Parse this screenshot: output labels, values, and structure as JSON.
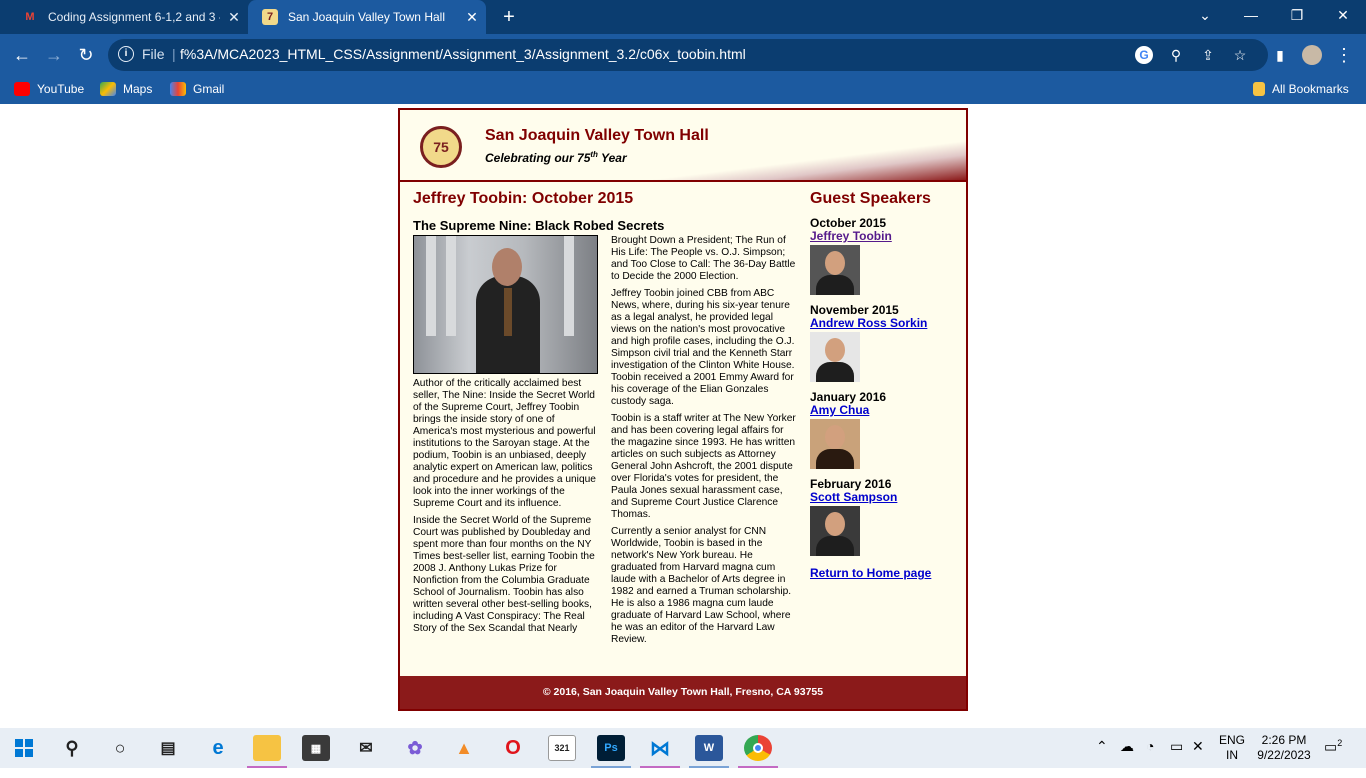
{
  "browser": {
    "tabs": [
      {
        "title": "Coding Assignment 6-1,2 and 3 -",
        "favicon": "gmail-icon",
        "active": false
      },
      {
        "title": "San Joaquin Valley Town Hall",
        "favicon": "town-hall-icon",
        "active": true
      }
    ],
    "new_tab": "+",
    "url_scheme": "File",
    "url": "f%3A/MCA2023_HTML_CSS/Assignment/Assignment_3/Assignment_3.2/c06x_toobin.html",
    "bookmarks": [
      {
        "label": "YouTube",
        "icon": "youtube-icon",
        "color": "#ff0000"
      },
      {
        "label": "Maps",
        "icon": "maps-icon",
        "color": "#34a853"
      },
      {
        "label": "Gmail",
        "icon": "gmail-icon",
        "color": "#ea4335"
      }
    ],
    "all_bookmarks": "All Bookmarks"
  },
  "page": {
    "site_title": "San Joaquin Valley Town Hall",
    "tagline_prefix": "Celebrating our ",
    "tagline_number": "75",
    "tagline_suffix_sup": "th",
    "tagline_end": " Year",
    "logo_text": "75",
    "heading": "Jeffrey Toobin: October 2015",
    "subheading": "The Supreme Nine: Black Robed Secrets",
    "left_paragraphs": [
      "Author of the critically acclaimed best seller, The Nine: Inside the Secret World of the Supreme Court, Jeffrey Toobin brings the inside story of one of America's most mysterious and powerful institutions to the Saroyan stage. At the podium, Toobin is an unbiased, deeply analytic expert on American law, politics and procedure and he provides a unique look into the inner workings of the Supreme Court and its influence.",
      "Inside the Secret World of the Supreme Court was published by Doubleday and spent more than four months on the NY Times best-seller list, earning Toobin the 2008 J. Anthony Lukas Prize for Nonfiction from the Columbia Graduate School of Journalism. Toobin has also written several other best-selling books, including A Vast Conspiracy: The Real Story of the Sex Scandal that Nearly"
    ],
    "right_paragraphs": [
      "Brought Down a President; The Run of His Life: The People vs. O.J. Simpson; and Too Close to Call: The 36-Day Battle to Decide the 2000 Election.",
      "Jeffrey Toobin joined CBB from ABC News, where, during his six-year tenure as a legal analyst, he provided legal views on the nation's most provocative and high profile cases, including the O.J. Simpson civil trial and the Kenneth Starr investigation of the Clinton White House. Toobin received a 2001 Emmy Award for his coverage of the Elian Gonzales custody saga.",
      "Toobin is a staff writer at The New Yorker and has been covering legal affairs for the magazine since 1993. He has written articles on such subjects as Attorney General John Ashcroft, the 2001 dispute over Florida's votes for president, the Paula Jones sexual harassment case, and Supreme Court Justice Clarence Thomas.",
      "Currently a senior analyst for CNN Worldwide, Toobin is based in the network's New York bureau. He graduated from Harvard magna cum laude with a Bachelor of Arts degree in 1982 and earned a Truman scholarship. He is also a 1986 magna cum laude graduate of Harvard Law School, where he was an editor of the Harvard Law Review."
    ],
    "sidebar_title": "Guest Speakers",
    "speakers": [
      {
        "month": "October 2015",
        "name": "Jeffrey Toobin"
      },
      {
        "month": "November 2015",
        "name": "Andrew Ross Sorkin"
      },
      {
        "month": "January 2016",
        "name": "Amy Chua"
      },
      {
        "month": "February 2016",
        "name": "Scott Sampson"
      }
    ],
    "home_link": "Return to Home page",
    "footer": "© 2016, San Joaquin Valley Town Hall, Fresno, CA 93755"
  },
  "taskbar": {
    "language": "ENG",
    "region": "IN",
    "time": "2:26 PM",
    "date": "9/22/2023",
    "notification_count": "2"
  },
  "colors": {
    "brand_maroon": "#800000",
    "page_bg": "#fffded",
    "chrome_dark": "#0b3d70",
    "chrome_light": "#1c5aa0"
  }
}
